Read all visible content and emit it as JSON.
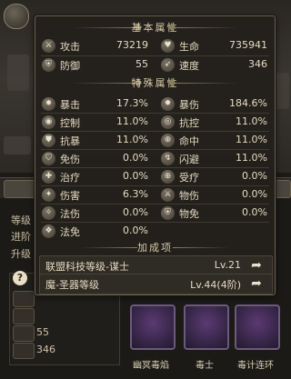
{
  "background": {
    "left_labels": [
      "等级",
      "进阶",
      "升级"
    ],
    "stat_values": [
      "55",
      "346"
    ],
    "skills": [
      "幽冥毒焰",
      "毒士",
      "毒计连环"
    ],
    "help_label": "?"
  },
  "popup": {
    "basic_header": "基本属性",
    "basic": [
      {
        "left": {
          "label": "攻击",
          "value": "73219",
          "icon": "sword-icon"
        },
        "right": {
          "label": "生命",
          "value": "735941",
          "icon": "heart-icon"
        }
      },
      {
        "left": {
          "label": "防御",
          "value": "55",
          "icon": "shield-icon"
        },
        "right": {
          "label": "速度",
          "value": "346",
          "icon": "boot-icon"
        }
      }
    ],
    "special_header": "特殊属性",
    "special": [
      {
        "left": {
          "label": "暴击",
          "value": "17.3%"
        },
        "right": {
          "label": "暴伤",
          "value": "184.6%"
        }
      },
      {
        "left": {
          "label": "控制",
          "value": "11.0%"
        },
        "right": {
          "label": "抗控",
          "value": "11.0%"
        }
      },
      {
        "left": {
          "label": "抗暴",
          "value": "11.0%"
        },
        "right": {
          "label": "命中",
          "value": "11.0%"
        }
      },
      {
        "left": {
          "label": "免伤",
          "value": "0.0%"
        },
        "right": {
          "label": "闪避",
          "value": "11.0%"
        }
      },
      {
        "left": {
          "label": "治疗",
          "value": "0.0%"
        },
        "right": {
          "label": "受疗",
          "value": "0.0%"
        }
      },
      {
        "left": {
          "label": "伤害",
          "value": "6.3%"
        },
        "right": {
          "label": "物伤",
          "value": "0.0%"
        }
      },
      {
        "left": {
          "label": "法伤",
          "value": "0.0%"
        },
        "right": {
          "label": "物免",
          "value": "0.0%"
        }
      },
      {
        "left": {
          "label": "法免",
          "value": "0.0%"
        },
        "right": null
      }
    ],
    "bonus_header": "加成项",
    "bonus": [
      {
        "label": "联盟科技等级-谋士",
        "value": "Lv.21"
      },
      {
        "label": "魔-圣器等级",
        "value": "Lv.44(4阶)"
      }
    ]
  }
}
